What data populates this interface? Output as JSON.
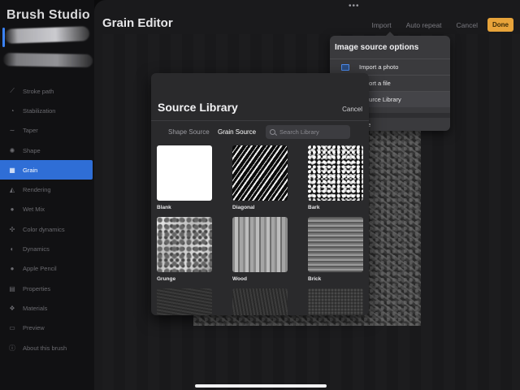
{
  "sidebar": {
    "title": "Brush Studio",
    "items": [
      {
        "label": "Stroke path",
        "icon": "stroke-path-icon",
        "glyph": "⟋"
      },
      {
        "label": "Stabilization",
        "icon": "stabilization-icon",
        "glyph": "◔"
      },
      {
        "label": "Taper",
        "icon": "taper-icon",
        "glyph": "∼"
      },
      {
        "label": "Shape",
        "icon": "shape-icon",
        "glyph": "✺"
      },
      {
        "label": "Grain",
        "icon": "grain-icon",
        "glyph": "▦"
      },
      {
        "label": "Rendering",
        "icon": "rendering-icon",
        "glyph": "◭"
      },
      {
        "label": "Wet Mix",
        "icon": "wet-mix-icon",
        "glyph": "💧"
      },
      {
        "label": "Color dynamics",
        "icon": "color-dynamics-icon",
        "glyph": "✣"
      },
      {
        "label": "Dynamics",
        "icon": "dynamics-icon",
        "glyph": "◐"
      },
      {
        "label": "Apple Pencil",
        "icon": "apple-pencil-icon",
        "glyph": "●"
      },
      {
        "label": "Properties",
        "icon": "properties-icon",
        "glyph": "▤"
      },
      {
        "label": "Materials",
        "icon": "materials-icon",
        "glyph": "❖"
      },
      {
        "label": "Preview",
        "icon": "preview-icon",
        "glyph": "▭"
      },
      {
        "label": "About this brush",
        "icon": "about-icon",
        "glyph": "ⓘ"
      }
    ],
    "active_item": "Grain"
  },
  "header": {
    "title": "Grain Editor",
    "import_label": "Import",
    "auto_repeat_label": "Auto repeat",
    "cancel_label": "Cancel",
    "done_label": "Done",
    "done_color": "#e7a33a"
  },
  "image_source_popover": {
    "title": "Image source options",
    "items": [
      {
        "label": "Import a photo"
      },
      {
        "label": "port a file"
      },
      {
        "label": "ource Library"
      },
      {
        "label": "te"
      }
    ]
  },
  "source_library": {
    "title": "Source Library",
    "cancel_label": "Cancel",
    "tabs": [
      {
        "label": "Shape Source",
        "selected": false
      },
      {
        "label": "Grain Source",
        "selected": true
      }
    ],
    "search": {
      "placeholder": "Search Library",
      "value": ""
    },
    "tiles": [
      {
        "label": "Blank",
        "texture": "t-blank"
      },
      {
        "label": "Diagonal",
        "texture": "t-diagonal"
      },
      {
        "label": "Bark",
        "texture": "t-bark"
      },
      {
        "label": "Grunge",
        "texture": "t-grunge"
      },
      {
        "label": "Wood",
        "texture": "t-wood"
      },
      {
        "label": "Brick",
        "texture": "t-brick"
      },
      {
        "label": "",
        "texture": "t-dark1"
      },
      {
        "label": "",
        "texture": "t-dark2"
      },
      {
        "label": "",
        "texture": "t-dark3"
      }
    ]
  },
  "colors": {
    "accent_blue": "#2f6ed6",
    "done_orange": "#e7a33a"
  }
}
